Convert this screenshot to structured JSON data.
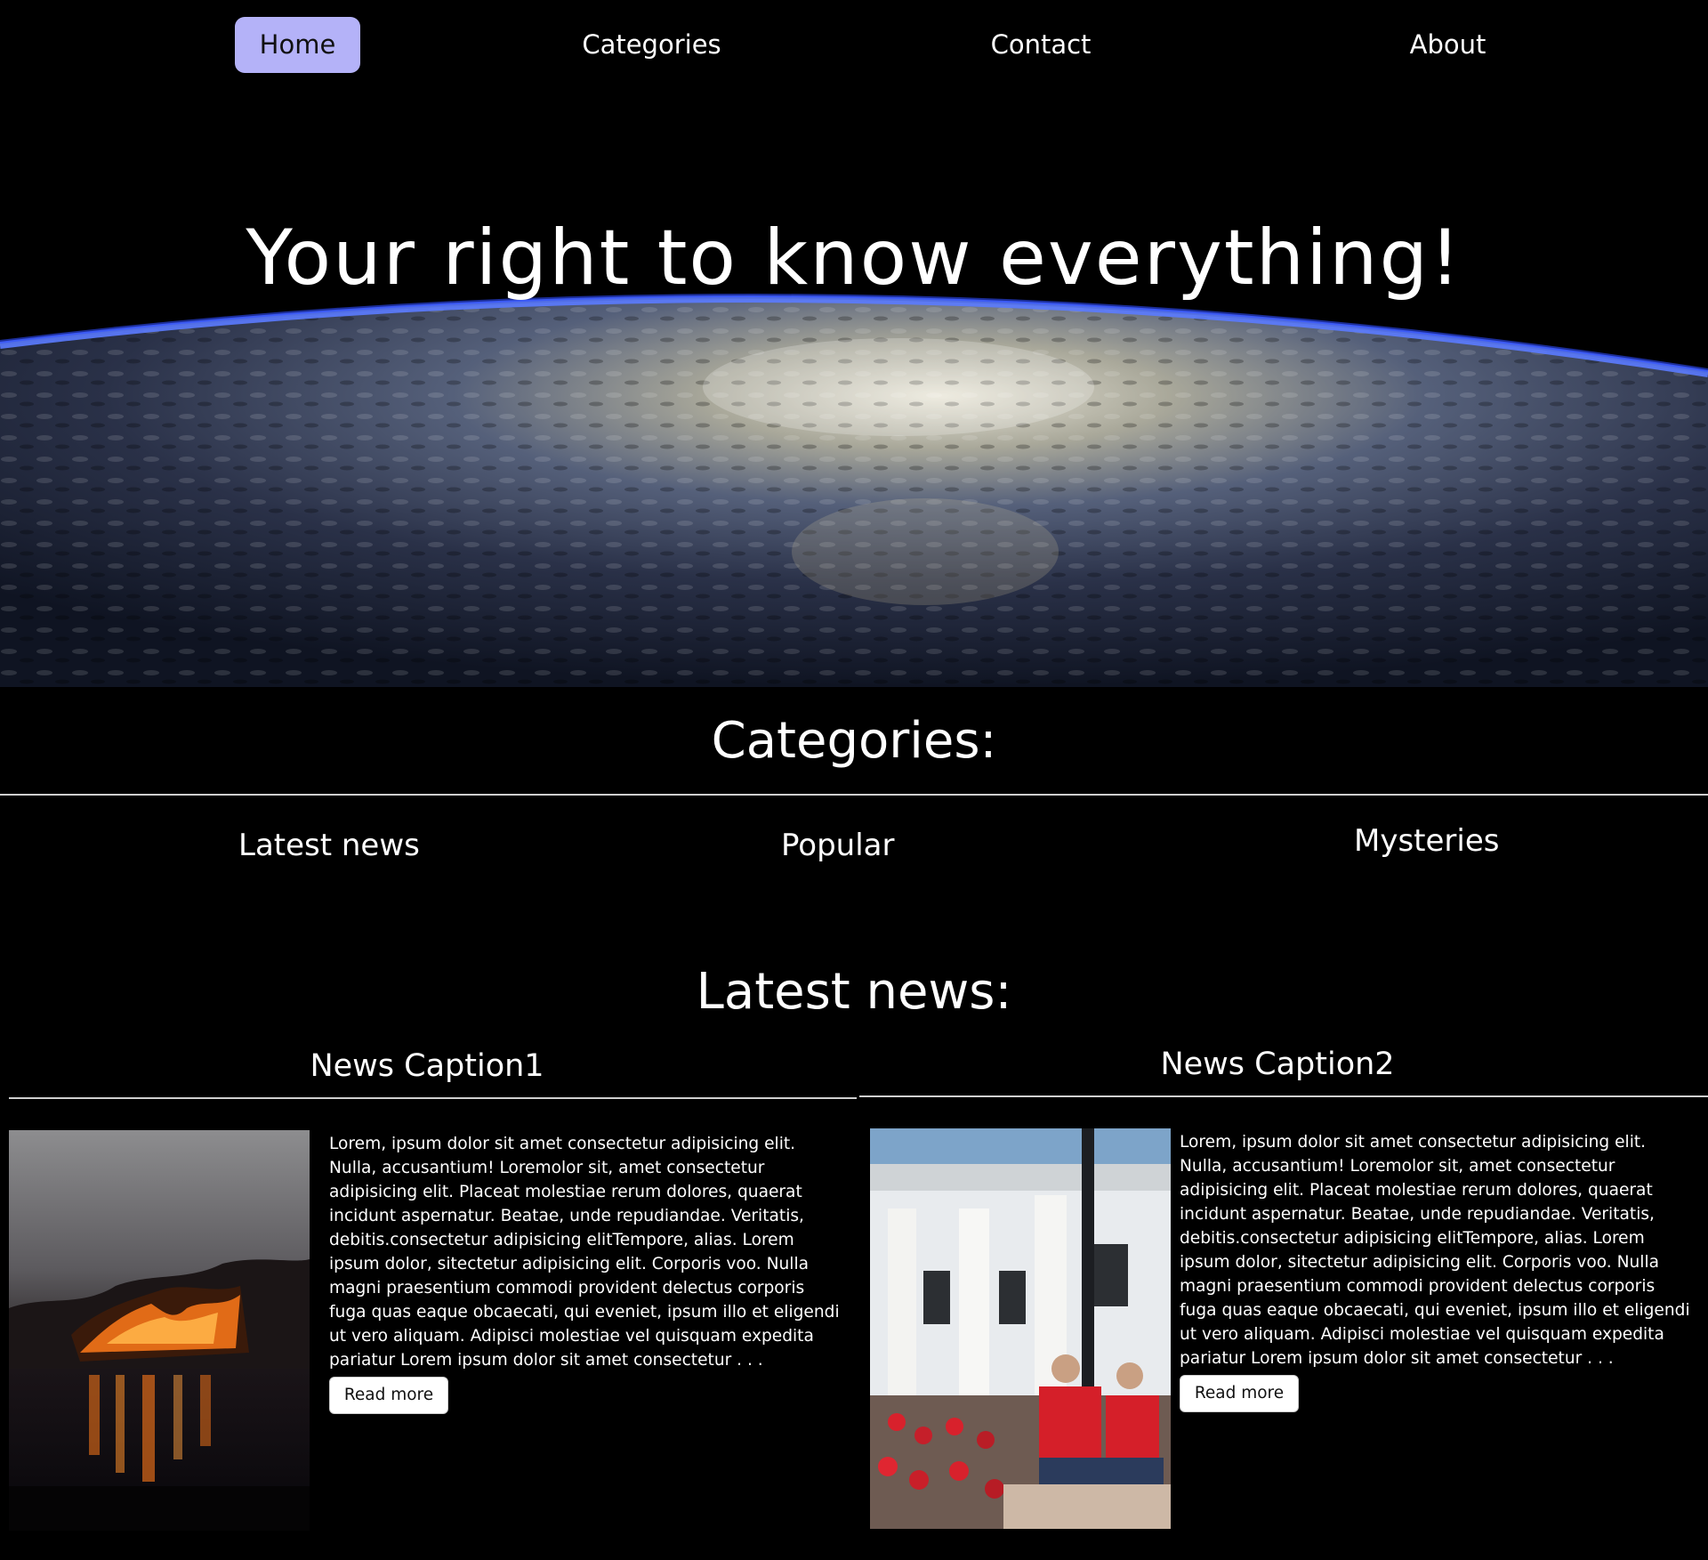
{
  "nav": {
    "items": [
      {
        "label": "Home",
        "active": true
      },
      {
        "label": "Categories",
        "active": false
      },
      {
        "label": "Contact",
        "active": false
      },
      {
        "label": "About",
        "active": false
      }
    ],
    "active_color": "#b4b2f8"
  },
  "hero": {
    "title": "Your right to know everything!"
  },
  "categories": {
    "heading": "Categories:",
    "items": [
      "Latest news",
      "Popular",
      "Mysteries"
    ]
  },
  "latest": {
    "heading": "Latest news:",
    "articles": [
      {
        "caption": "News Caption1",
        "body": "Lorem, ipsum dolor sit amet consectetur adipisicing elit. Nulla, accusantium! Loremolor sit, amet consectetur adipisicing elit. Placeat molestiae rerum dolores, quaerat incidunt aspernatur. Beatae, unde repudiandae. Veritatis, debitis.consectetur adipisicing elitTempore, alias. Lorem ipsum dolor, sitectetur adipisicing elit. Corporis voo. Nulla magni praesentium commodi provident delectus corporis fuga quas eaque obcaecati, qui eveniet, ipsum illo et eligendi ut vero aliquam. Adipisci molestiae vel quisquam expedita pariatur Lorem ipsum dolor sit amet consectetur . . .",
        "button": "Read more"
      },
      {
        "caption": "News Caption2",
        "body": "Lorem, ipsum dolor sit amet consectetur adipisicing elit. Nulla, accusantium! Loremolor sit, amet consectetur adipisicing elit. Placeat molestiae rerum dolores, quaerat incidunt aspernatur. Beatae, unde repudiandae. Veritatis, debitis.consectetur adipisicing elitTempore, alias. Lorem ipsum dolor, sitectetur adipisicing elit. Corporis voo. Nulla magni praesentium commodi provident delectus corporis fuga quas eaque obcaecati, qui eveniet, ipsum illo et eligendi ut vero aliquam. Adipisci molestiae vel quisquam expedita pariatur Lorem ipsum dolor sit amet consectetur . . .",
        "button": "Read more"
      }
    ]
  }
}
